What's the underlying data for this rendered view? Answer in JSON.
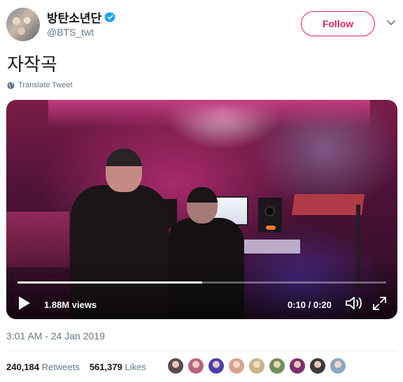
{
  "author": {
    "display_name": "방탄소년단",
    "handle": "@BTS_twt",
    "verified_icon": "verified-badge-icon"
  },
  "actions": {
    "follow_label": "Follow",
    "menu_icon": "chevron-down-icon"
  },
  "tweet": {
    "text": "자작곡",
    "translate_label": "Translate Tweet"
  },
  "video": {
    "views": "1.88M views",
    "time": "0:10 / 0:20",
    "progress": 0.5
  },
  "meta": {
    "timestamp": "3:01 AM - 24 Jan 2019",
    "retweets_count": "240,184",
    "retweets_label": "Retweets",
    "likes_count": "561,379",
    "likes_label": "Likes"
  },
  "likers": [
    {
      "color": "#5a4a52"
    },
    {
      "color": "#b4667f"
    },
    {
      "color": "#4a3fa8"
    },
    {
      "color": "#d9a28f"
    },
    {
      "color": "#c7b58a"
    },
    {
      "color": "#6f8f5a"
    },
    {
      "color": "#7c2f6a"
    },
    {
      "color": "#3a3a3a"
    },
    {
      "color": "#8aa6c2"
    }
  ],
  "colors": {
    "follow": "#e0245e",
    "verified": "#1da1f2",
    "muted": "#657786"
  }
}
